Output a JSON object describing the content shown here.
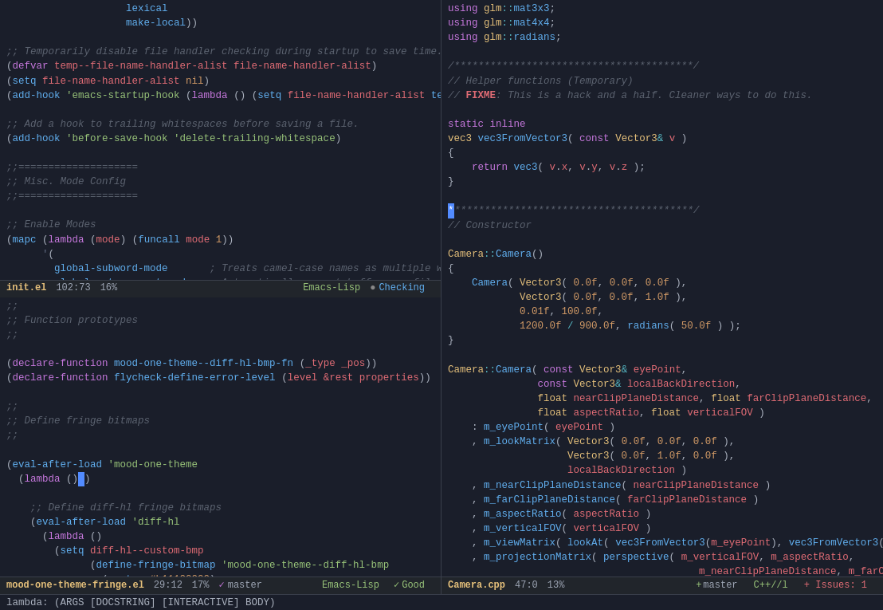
{
  "left_pane": {
    "status_bar": {
      "filename": "mood-one-theme-fringe.el",
      "position": "29:12",
      "percent": "17%",
      "branch": "master",
      "mode": "Emacs-Lisp",
      "check": "✓ Good"
    },
    "status_bar2": {
      "filename": "init.el",
      "position": "102:73",
      "percent": "16%",
      "mode": "Emacs-Lisp",
      "checking": "Checking"
    }
  },
  "right_pane": {
    "status_bar": {
      "filename": "Camera.cpp",
      "position": "47:0",
      "percent": "13%",
      "branch": "master",
      "mode": "C++//l",
      "issues": "+ Issues: 1"
    }
  },
  "minibuffer": {
    "text": "lambda: (ARGS [DOCSTRING] [INTERACTIVE] BODY)"
  }
}
